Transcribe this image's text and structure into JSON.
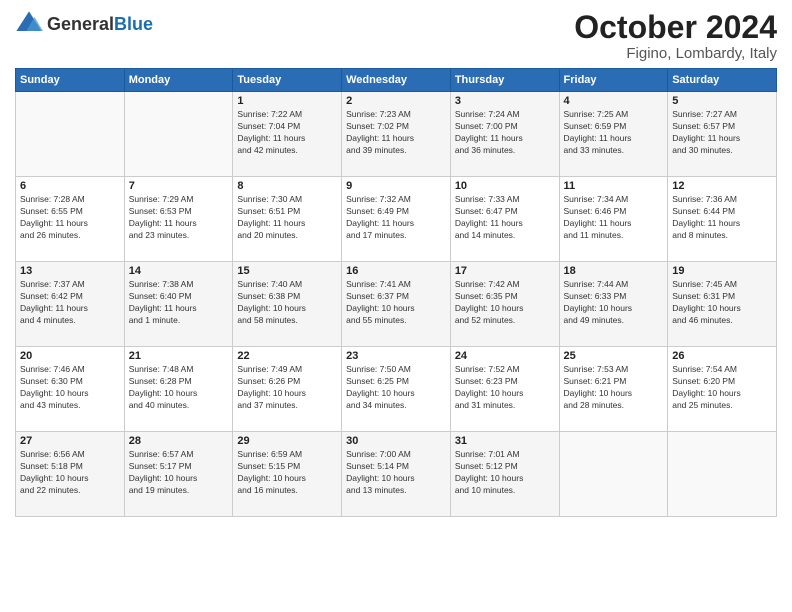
{
  "header": {
    "logo_general": "General",
    "logo_blue": "Blue",
    "month": "October 2024",
    "location": "Figino, Lombardy, Italy"
  },
  "weekdays": [
    "Sunday",
    "Monday",
    "Tuesday",
    "Wednesday",
    "Thursday",
    "Friday",
    "Saturday"
  ],
  "weeks": [
    [
      {
        "day": "",
        "info": ""
      },
      {
        "day": "",
        "info": ""
      },
      {
        "day": "1",
        "info": "Sunrise: 7:22 AM\nSunset: 7:04 PM\nDaylight: 11 hours\nand 42 minutes."
      },
      {
        "day": "2",
        "info": "Sunrise: 7:23 AM\nSunset: 7:02 PM\nDaylight: 11 hours\nand 39 minutes."
      },
      {
        "day": "3",
        "info": "Sunrise: 7:24 AM\nSunset: 7:00 PM\nDaylight: 11 hours\nand 36 minutes."
      },
      {
        "day": "4",
        "info": "Sunrise: 7:25 AM\nSunset: 6:59 PM\nDaylight: 11 hours\nand 33 minutes."
      },
      {
        "day": "5",
        "info": "Sunrise: 7:27 AM\nSunset: 6:57 PM\nDaylight: 11 hours\nand 30 minutes."
      }
    ],
    [
      {
        "day": "6",
        "info": "Sunrise: 7:28 AM\nSunset: 6:55 PM\nDaylight: 11 hours\nand 26 minutes."
      },
      {
        "day": "7",
        "info": "Sunrise: 7:29 AM\nSunset: 6:53 PM\nDaylight: 11 hours\nand 23 minutes."
      },
      {
        "day": "8",
        "info": "Sunrise: 7:30 AM\nSunset: 6:51 PM\nDaylight: 11 hours\nand 20 minutes."
      },
      {
        "day": "9",
        "info": "Sunrise: 7:32 AM\nSunset: 6:49 PM\nDaylight: 11 hours\nand 17 minutes."
      },
      {
        "day": "10",
        "info": "Sunrise: 7:33 AM\nSunset: 6:47 PM\nDaylight: 11 hours\nand 14 minutes."
      },
      {
        "day": "11",
        "info": "Sunrise: 7:34 AM\nSunset: 6:46 PM\nDaylight: 11 hours\nand 11 minutes."
      },
      {
        "day": "12",
        "info": "Sunrise: 7:36 AM\nSunset: 6:44 PM\nDaylight: 11 hours\nand 8 minutes."
      }
    ],
    [
      {
        "day": "13",
        "info": "Sunrise: 7:37 AM\nSunset: 6:42 PM\nDaylight: 11 hours\nand 4 minutes."
      },
      {
        "day": "14",
        "info": "Sunrise: 7:38 AM\nSunset: 6:40 PM\nDaylight: 11 hours\nand 1 minute."
      },
      {
        "day": "15",
        "info": "Sunrise: 7:40 AM\nSunset: 6:38 PM\nDaylight: 10 hours\nand 58 minutes."
      },
      {
        "day": "16",
        "info": "Sunrise: 7:41 AM\nSunset: 6:37 PM\nDaylight: 10 hours\nand 55 minutes."
      },
      {
        "day": "17",
        "info": "Sunrise: 7:42 AM\nSunset: 6:35 PM\nDaylight: 10 hours\nand 52 minutes."
      },
      {
        "day": "18",
        "info": "Sunrise: 7:44 AM\nSunset: 6:33 PM\nDaylight: 10 hours\nand 49 minutes."
      },
      {
        "day": "19",
        "info": "Sunrise: 7:45 AM\nSunset: 6:31 PM\nDaylight: 10 hours\nand 46 minutes."
      }
    ],
    [
      {
        "day": "20",
        "info": "Sunrise: 7:46 AM\nSunset: 6:30 PM\nDaylight: 10 hours\nand 43 minutes."
      },
      {
        "day": "21",
        "info": "Sunrise: 7:48 AM\nSunset: 6:28 PM\nDaylight: 10 hours\nand 40 minutes."
      },
      {
        "day": "22",
        "info": "Sunrise: 7:49 AM\nSunset: 6:26 PM\nDaylight: 10 hours\nand 37 minutes."
      },
      {
        "day": "23",
        "info": "Sunrise: 7:50 AM\nSunset: 6:25 PM\nDaylight: 10 hours\nand 34 minutes."
      },
      {
        "day": "24",
        "info": "Sunrise: 7:52 AM\nSunset: 6:23 PM\nDaylight: 10 hours\nand 31 minutes."
      },
      {
        "day": "25",
        "info": "Sunrise: 7:53 AM\nSunset: 6:21 PM\nDaylight: 10 hours\nand 28 minutes."
      },
      {
        "day": "26",
        "info": "Sunrise: 7:54 AM\nSunset: 6:20 PM\nDaylight: 10 hours\nand 25 minutes."
      }
    ],
    [
      {
        "day": "27",
        "info": "Sunrise: 6:56 AM\nSunset: 5:18 PM\nDaylight: 10 hours\nand 22 minutes."
      },
      {
        "day": "28",
        "info": "Sunrise: 6:57 AM\nSunset: 5:17 PM\nDaylight: 10 hours\nand 19 minutes."
      },
      {
        "day": "29",
        "info": "Sunrise: 6:59 AM\nSunset: 5:15 PM\nDaylight: 10 hours\nand 16 minutes."
      },
      {
        "day": "30",
        "info": "Sunrise: 7:00 AM\nSunset: 5:14 PM\nDaylight: 10 hours\nand 13 minutes."
      },
      {
        "day": "31",
        "info": "Sunrise: 7:01 AM\nSunset: 5:12 PM\nDaylight: 10 hours\nand 10 minutes."
      },
      {
        "day": "",
        "info": ""
      },
      {
        "day": "",
        "info": ""
      }
    ]
  ]
}
